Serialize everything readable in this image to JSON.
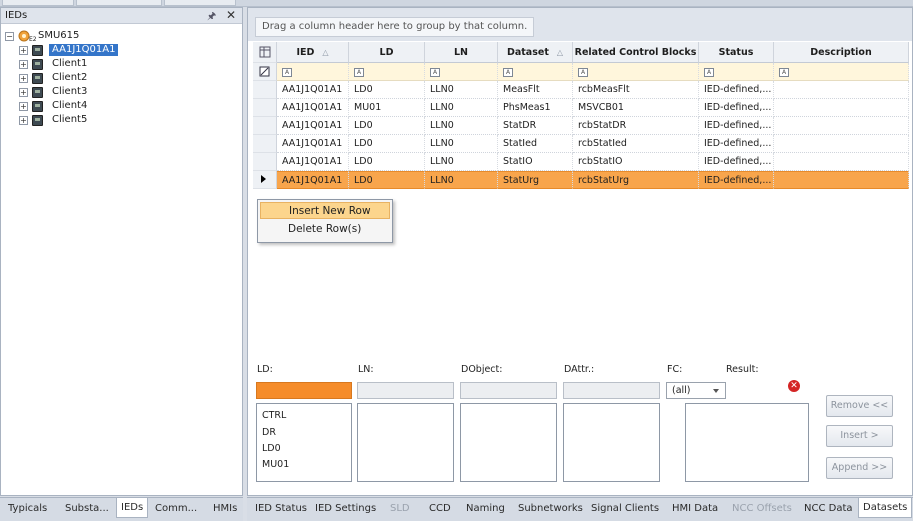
{
  "left_panel": {
    "title": "IEDs",
    "pin_icon": "pin-icon",
    "close_icon": "close-icon",
    "root": {
      "label": "SMU615",
      "subscript": "E2"
    },
    "items": [
      {
        "label": "AA1J1Q01A1",
        "selected": true
      },
      {
        "label": "Client1",
        "selected": false
      },
      {
        "label": "Client2",
        "selected": false
      },
      {
        "label": "Client3",
        "selected": false
      },
      {
        "label": "Client4",
        "selected": false
      },
      {
        "label": "Client5",
        "selected": false
      }
    ],
    "tabs": [
      "Typicals",
      "Substa...",
      "IEDs",
      "Comm...",
      "HMIs"
    ],
    "active_tab": "IEDs"
  },
  "grid": {
    "group_hint": "Drag a column header here to group by that column.",
    "columns": [
      "IED",
      "LD",
      "LN",
      "Dataset",
      "Related Control Blocks",
      "Status",
      "Description"
    ],
    "rows": [
      [
        "AA1J1Q01A1",
        "LD0",
        "LLN0",
        "MeasFlt",
        "rcbMeasFlt",
        "IED-defined,...",
        ""
      ],
      [
        "AA1J1Q01A1",
        "MU01",
        "LLN0",
        "PhsMeas1",
        "MSVCB01",
        "IED-defined,...",
        ""
      ],
      [
        "AA1J1Q01A1",
        "LD0",
        "LLN0",
        "StatDR",
        "rcbStatDR",
        "IED-defined,...",
        ""
      ],
      [
        "AA1J1Q01A1",
        "LD0",
        "LLN0",
        "StatIed",
        "rcbStatIed",
        "IED-defined,...",
        ""
      ],
      [
        "AA1J1Q01A1",
        "LD0",
        "LLN0",
        "StatIO",
        "rcbStatIO",
        "IED-defined,...",
        ""
      ],
      [
        "AA1J1Q01A1",
        "LD0",
        "LLN0",
        "StatUrg",
        "rcbStatUrg",
        "IED-defined,...",
        ""
      ]
    ],
    "selected_row": 5,
    "selection_color": "#f8a54c"
  },
  "context_menu": {
    "items": [
      "Insert New Row",
      "Delete Row(s)"
    ],
    "highlighted": 0
  },
  "filter_area": {
    "ld_label": "LD:",
    "ln_label": "LN:",
    "dobject_label": "DObject:",
    "dattr_label": "DAttr.:",
    "fc_label": "FC:",
    "result_label": "Result:",
    "fc_value": "(all)",
    "ld_options": [
      "CTRL",
      "DR",
      "LD0",
      "MU01"
    ],
    "buttons": {
      "remove": "Remove <<",
      "insert": "Insert >",
      "append": "Append >>"
    },
    "accent": "#f58c2a"
  },
  "bottom_tabs": [
    "IED Status",
    "IED Settings",
    "SLD",
    "CCD",
    "Naming",
    "Subnetworks",
    "Signal Clients",
    "HMI Data",
    "NCC Offsets",
    "NCC Data",
    "Datasets"
  ],
  "bottom_tabs_disabled": [
    "SLD",
    "NCC Offsets"
  ],
  "bottom_tab_active": "Datasets"
}
